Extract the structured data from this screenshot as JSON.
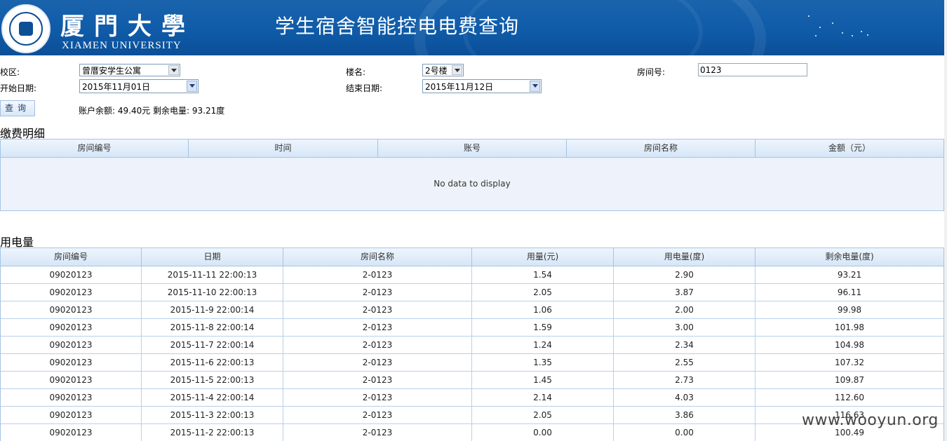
{
  "header": {
    "university_cn": "厦門大學",
    "university_en": "XIAMEN UNIVERSITY",
    "system_title": "学生宿舍智能控电电费查询"
  },
  "filters": {
    "campus_label": "校区:",
    "campus_value": "曾厝安学生公寓",
    "building_label": "楼名:",
    "building_value": "2号楼",
    "room_label": "房间号:",
    "room_value": "0123",
    "start_label": "开始日期:",
    "start_value": "2015年11月01日",
    "end_label": "结束日期:",
    "end_value": "2015年11月12日",
    "query_button": "查询",
    "balance_text": "账户余额: 49.40元 剩余电量: 93.21度"
  },
  "payment": {
    "title": "缴费明细",
    "columns": [
      "房间编号",
      "时间",
      "账号",
      "房间名称",
      "金额（元）"
    ],
    "empty_text": "No data to display"
  },
  "usage": {
    "title": "用电量",
    "columns": [
      "房间编号",
      "日期",
      "房间名称",
      "用量(元)",
      "用电量(度)",
      "剩余电量(度)"
    ],
    "rows": [
      [
        "09020123",
        "2015-11-11 22:00:13",
        "2-0123",
        "1.54",
        "2.90",
        "93.21"
      ],
      [
        "09020123",
        "2015-11-10 22:00:13",
        "2-0123",
        "2.05",
        "3.87",
        "96.11"
      ],
      [
        "09020123",
        "2015-11-9 22:00:14",
        "2-0123",
        "1.06",
        "2.00",
        "99.98"
      ],
      [
        "09020123",
        "2015-11-8 22:00:14",
        "2-0123",
        "1.59",
        "3.00",
        "101.98"
      ],
      [
        "09020123",
        "2015-11-7 22:00:14",
        "2-0123",
        "1.24",
        "2.34",
        "104.98"
      ],
      [
        "09020123",
        "2015-11-6 22:00:13",
        "2-0123",
        "1.35",
        "2.55",
        "107.32"
      ],
      [
        "09020123",
        "2015-11-5 22:00:13",
        "2-0123",
        "1.45",
        "2.73",
        "109.87"
      ],
      [
        "09020123",
        "2015-11-4 22:00:14",
        "2-0123",
        "2.14",
        "4.03",
        "112.60"
      ],
      [
        "09020123",
        "2015-11-3 22:00:13",
        "2-0123",
        "2.05",
        "3.86",
        "116.63"
      ],
      [
        "09020123",
        "2015-11-2 22:00:13",
        "2-0123",
        "0.00",
        "0.00",
        "100.49"
      ]
    ]
  },
  "watermark": "www.wooyun.org"
}
